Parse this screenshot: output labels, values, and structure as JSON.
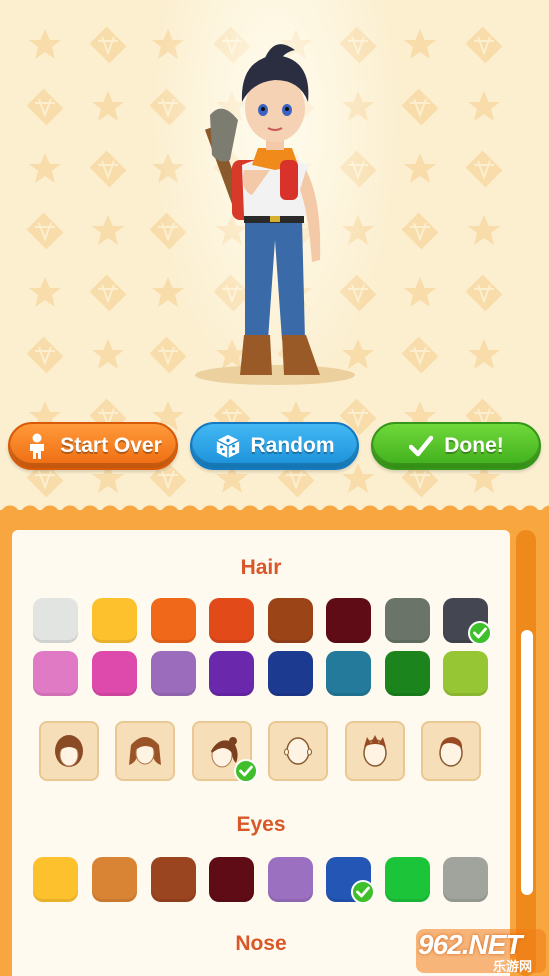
{
  "buttons": {
    "start_over": "Start Over",
    "random": "Random",
    "done": "Done!"
  },
  "sections": {
    "hair": "Hair",
    "eyes": "Eyes",
    "nose": "Nose"
  },
  "hair_colors": [
    "#e1e4e0",
    "#fdc12e",
    "#f0681a",
    "#e24a1a",
    "#9a4418",
    "#600c16",
    "#6a7468",
    "#444652",
    "#e07ac4",
    "#de4aac",
    "#9c6cbc",
    "#6a28ac",
    "#1c3a90",
    "#237a9a",
    "#1c841c",
    "#96c634"
  ],
  "hair_color_selected": 7,
  "hair_styles": [
    "bob-hair-icon",
    "wavy-hair-icon",
    "ponytail-hair-icon",
    "bald-icon",
    "spiky-hair-icon",
    "short-hair-icon"
  ],
  "hair_style_selected": 2,
  "eye_colors": [
    "#fdc12e",
    "#d98434",
    "#9a4420",
    "#600c16",
    "#9c70c0",
    "#2456b6",
    "#1cc43a",
    "#a0a49c"
  ],
  "eye_color_selected": 5,
  "watermark": {
    "text": "962.NET",
    "sub": "乐游网"
  },
  "colors": {
    "accent_orange": "#f8a640",
    "title_color": "#d8582a",
    "check_green": "#3fbf2a"
  }
}
